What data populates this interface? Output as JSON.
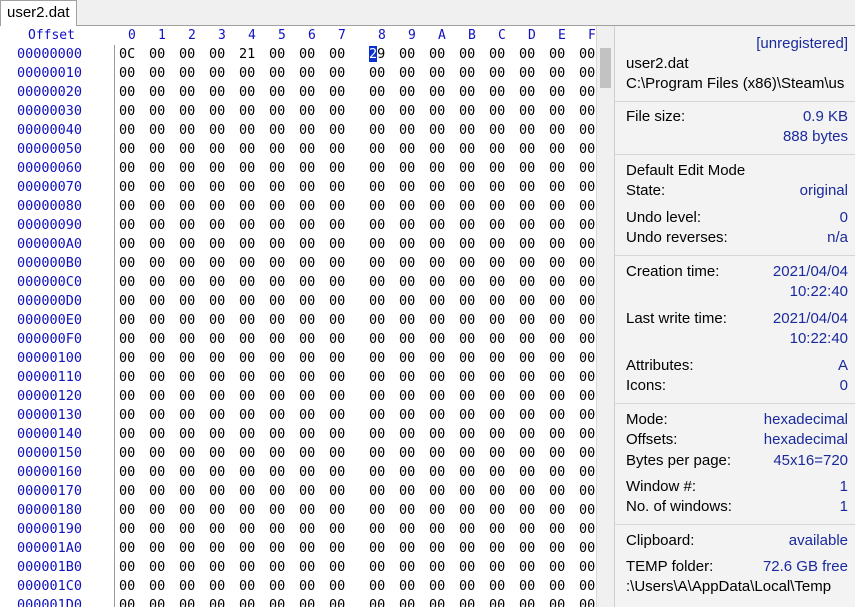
{
  "tab": {
    "label": "user2.dat"
  },
  "hex": {
    "offset_header": "Offset",
    "columns": [
      "0",
      "1",
      "2",
      "3",
      "4",
      "5",
      "6",
      "7",
      "8",
      "9",
      "A",
      "B",
      "C",
      "D",
      "E",
      "F"
    ],
    "rows": [
      {
        "offset": "00000000",
        "bytes": [
          "0C",
          "00",
          "00",
          "00",
          "21",
          "00",
          "00",
          "00",
          "29",
          "00",
          "00",
          "00",
          "00",
          "00",
          "00",
          "00"
        ]
      },
      {
        "offset": "00000010",
        "bytes": [
          "00",
          "00",
          "00",
          "00",
          "00",
          "00",
          "00",
          "00",
          "00",
          "00",
          "00",
          "00",
          "00",
          "00",
          "00",
          "00"
        ]
      },
      {
        "offset": "00000020",
        "bytes": [
          "00",
          "00",
          "00",
          "00",
          "00",
          "00",
          "00",
          "00",
          "00",
          "00",
          "00",
          "00",
          "00",
          "00",
          "00",
          "00"
        ]
      },
      {
        "offset": "00000030",
        "bytes": [
          "00",
          "00",
          "00",
          "00",
          "00",
          "00",
          "00",
          "00",
          "00",
          "00",
          "00",
          "00",
          "00",
          "00",
          "00",
          "00"
        ]
      },
      {
        "offset": "00000040",
        "bytes": [
          "00",
          "00",
          "00",
          "00",
          "00",
          "00",
          "00",
          "00",
          "00",
          "00",
          "00",
          "00",
          "00",
          "00",
          "00",
          "00"
        ]
      },
      {
        "offset": "00000050",
        "bytes": [
          "00",
          "00",
          "00",
          "00",
          "00",
          "00",
          "00",
          "00",
          "00",
          "00",
          "00",
          "00",
          "00",
          "00",
          "00",
          "00"
        ]
      },
      {
        "offset": "00000060",
        "bytes": [
          "00",
          "00",
          "00",
          "00",
          "00",
          "00",
          "00",
          "00",
          "00",
          "00",
          "00",
          "00",
          "00",
          "00",
          "00",
          "00"
        ]
      },
      {
        "offset": "00000070",
        "bytes": [
          "00",
          "00",
          "00",
          "00",
          "00",
          "00",
          "00",
          "00",
          "00",
          "00",
          "00",
          "00",
          "00",
          "00",
          "00",
          "00"
        ]
      },
      {
        "offset": "00000080",
        "bytes": [
          "00",
          "00",
          "00",
          "00",
          "00",
          "00",
          "00",
          "00",
          "00",
          "00",
          "00",
          "00",
          "00",
          "00",
          "00",
          "00"
        ]
      },
      {
        "offset": "00000090",
        "bytes": [
          "00",
          "00",
          "00",
          "00",
          "00",
          "00",
          "00",
          "00",
          "00",
          "00",
          "00",
          "00",
          "00",
          "00",
          "00",
          "00"
        ]
      },
      {
        "offset": "000000A0",
        "bytes": [
          "00",
          "00",
          "00",
          "00",
          "00",
          "00",
          "00",
          "00",
          "00",
          "00",
          "00",
          "00",
          "00",
          "00",
          "00",
          "00"
        ]
      },
      {
        "offset": "000000B0",
        "bytes": [
          "00",
          "00",
          "00",
          "00",
          "00",
          "00",
          "00",
          "00",
          "00",
          "00",
          "00",
          "00",
          "00",
          "00",
          "00",
          "00"
        ]
      },
      {
        "offset": "000000C0",
        "bytes": [
          "00",
          "00",
          "00",
          "00",
          "00",
          "00",
          "00",
          "00",
          "00",
          "00",
          "00",
          "00",
          "00",
          "00",
          "00",
          "00"
        ]
      },
      {
        "offset": "000000D0",
        "bytes": [
          "00",
          "00",
          "00",
          "00",
          "00",
          "00",
          "00",
          "00",
          "00",
          "00",
          "00",
          "00",
          "00",
          "00",
          "00",
          "00"
        ]
      },
      {
        "offset": "000000E0",
        "bytes": [
          "00",
          "00",
          "00",
          "00",
          "00",
          "00",
          "00",
          "00",
          "00",
          "00",
          "00",
          "00",
          "00",
          "00",
          "00",
          "00"
        ]
      },
      {
        "offset": "000000F0",
        "bytes": [
          "00",
          "00",
          "00",
          "00",
          "00",
          "00",
          "00",
          "00",
          "00",
          "00",
          "00",
          "00",
          "00",
          "00",
          "00",
          "00"
        ]
      },
      {
        "offset": "00000100",
        "bytes": [
          "00",
          "00",
          "00",
          "00",
          "00",
          "00",
          "00",
          "00",
          "00",
          "00",
          "00",
          "00",
          "00",
          "00",
          "00",
          "00"
        ]
      },
      {
        "offset": "00000110",
        "bytes": [
          "00",
          "00",
          "00",
          "00",
          "00",
          "00",
          "00",
          "00",
          "00",
          "00",
          "00",
          "00",
          "00",
          "00",
          "00",
          "00"
        ]
      },
      {
        "offset": "00000120",
        "bytes": [
          "00",
          "00",
          "00",
          "00",
          "00",
          "00",
          "00",
          "00",
          "00",
          "00",
          "00",
          "00",
          "00",
          "00",
          "00",
          "00"
        ]
      },
      {
        "offset": "00000130",
        "bytes": [
          "00",
          "00",
          "00",
          "00",
          "00",
          "00",
          "00",
          "00",
          "00",
          "00",
          "00",
          "00",
          "00",
          "00",
          "00",
          "00"
        ]
      },
      {
        "offset": "00000140",
        "bytes": [
          "00",
          "00",
          "00",
          "00",
          "00",
          "00",
          "00",
          "00",
          "00",
          "00",
          "00",
          "00",
          "00",
          "00",
          "00",
          "00"
        ]
      },
      {
        "offset": "00000150",
        "bytes": [
          "00",
          "00",
          "00",
          "00",
          "00",
          "00",
          "00",
          "00",
          "00",
          "00",
          "00",
          "00",
          "00",
          "00",
          "00",
          "00"
        ]
      },
      {
        "offset": "00000160",
        "bytes": [
          "00",
          "00",
          "00",
          "00",
          "00",
          "00",
          "00",
          "00",
          "00",
          "00",
          "00",
          "00",
          "00",
          "00",
          "00",
          "00"
        ]
      },
      {
        "offset": "00000170",
        "bytes": [
          "00",
          "00",
          "00",
          "00",
          "00",
          "00",
          "00",
          "00",
          "00",
          "00",
          "00",
          "00",
          "00",
          "00",
          "00",
          "00"
        ]
      },
      {
        "offset": "00000180",
        "bytes": [
          "00",
          "00",
          "00",
          "00",
          "00",
          "00",
          "00",
          "00",
          "00",
          "00",
          "00",
          "00",
          "00",
          "00",
          "00",
          "00"
        ]
      },
      {
        "offset": "00000190",
        "bytes": [
          "00",
          "00",
          "00",
          "00",
          "00",
          "00",
          "00",
          "00",
          "00",
          "00",
          "00",
          "00",
          "00",
          "00",
          "00",
          "00"
        ]
      },
      {
        "offset": "000001A0",
        "bytes": [
          "00",
          "00",
          "00",
          "00",
          "00",
          "00",
          "00",
          "00",
          "00",
          "00",
          "00",
          "00",
          "00",
          "00",
          "00",
          "00"
        ]
      },
      {
        "offset": "000001B0",
        "bytes": [
          "00",
          "00",
          "00",
          "00",
          "00",
          "00",
          "00",
          "00",
          "00",
          "00",
          "00",
          "00",
          "00",
          "00",
          "00",
          "00"
        ]
      },
      {
        "offset": "000001C0",
        "bytes": [
          "00",
          "00",
          "00",
          "00",
          "00",
          "00",
          "00",
          "00",
          "00",
          "00",
          "00",
          "00",
          "00",
          "00",
          "00",
          "00"
        ]
      },
      {
        "offset": "000001D0",
        "bytes": [
          "00",
          "00",
          "00",
          "00",
          "00",
          "00",
          "00",
          "00",
          "00",
          "00",
          "00",
          "00",
          "00",
          "00",
          "00",
          "00"
        ]
      }
    ],
    "selected": {
      "row": 0,
      "col": 8
    }
  },
  "info": {
    "registration": "[unregistered]",
    "file_name": "user2.dat",
    "file_path": "C:\\Program Files (x86)\\Steam\\us",
    "file_size_label": "File size:",
    "file_size_kb": "0.9 KB",
    "file_size_bytes": "888 bytes",
    "edit_mode_title": "Default Edit Mode",
    "state_label": "State:",
    "state_value": "original",
    "undo_level_label": "Undo level:",
    "undo_level_value": "0",
    "undo_reverses_label": "Undo reverses:",
    "undo_reverses_value": "n/a",
    "creation_label": "Creation time:",
    "creation_date": "2021/04/04",
    "creation_time": "10:22:40",
    "lastwrite_label": "Last write time:",
    "lastwrite_date": "2021/04/04",
    "lastwrite_time": "10:22:40",
    "attributes_label": "Attributes:",
    "attributes_value": "A",
    "icons_label": "Icons:",
    "icons_value": "0",
    "mode_label": "Mode:",
    "mode_value": "hexadecimal",
    "offsets_label": "Offsets:",
    "offsets_value": "hexadecimal",
    "bpp_label": "Bytes per page:",
    "bpp_value": "45x16=720",
    "window_label": "Window #:",
    "window_value": "1",
    "nwindows_label": "No. of windows:",
    "nwindows_value": "1",
    "clipboard_label": "Clipboard:",
    "clipboard_value": "available",
    "temp_label": "TEMP folder:",
    "temp_value": "72.6 GB free",
    "temp_path": ":\\Users\\A\\AppData\\Local\\Temp"
  }
}
